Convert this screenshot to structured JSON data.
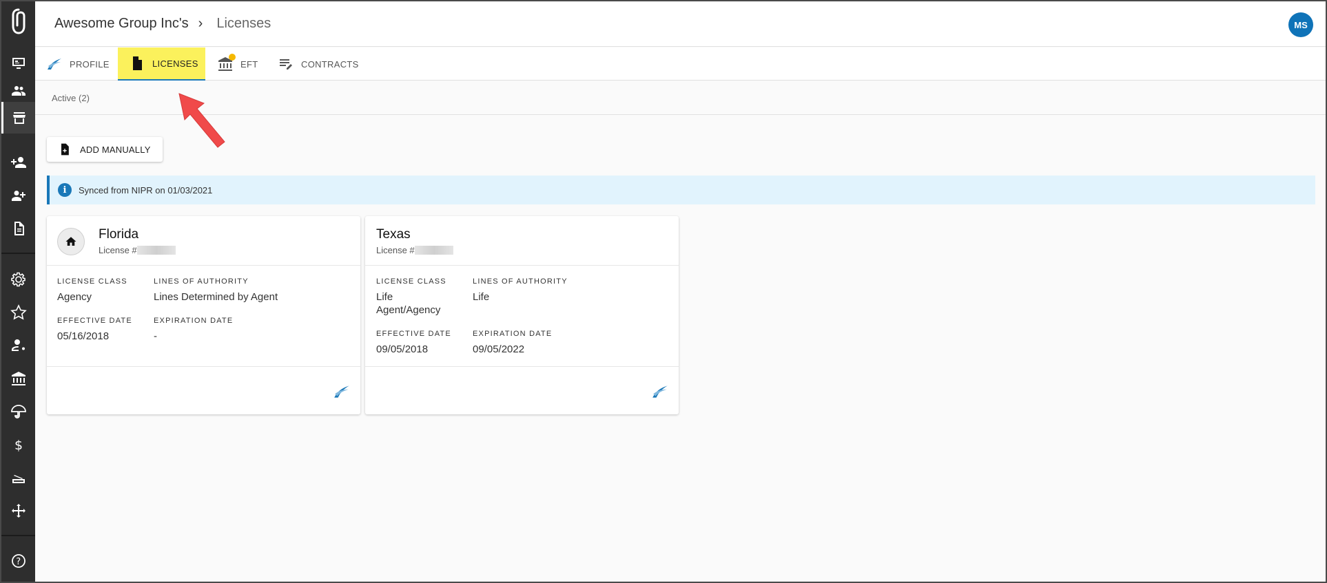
{
  "header": {
    "breadcrumb_root": "Awesome Group Inc's",
    "breadcrumb_separator": "›",
    "breadcrumb_current": "Licenses",
    "avatar_initials": "MS"
  },
  "tabs": [
    {
      "label": "PROFILE",
      "icon": "nipr-swoosh-icon",
      "selected": false
    },
    {
      "label": "LICENSES",
      "icon": "document-icon",
      "selected": true
    },
    {
      "label": "EFT",
      "icon": "bank-icon",
      "selected": false,
      "has_notification_dot": true
    },
    {
      "label": "CONTRACTS",
      "icon": "edit-list-icon",
      "selected": false
    }
  ],
  "subtabs": {
    "active_label": "Active (2)"
  },
  "actions": {
    "add_manually_label": "ADD MANUALLY"
  },
  "banner": {
    "text": "Synced from NIPR on 01/03/2021",
    "info_glyph": "i"
  },
  "licenses": [
    {
      "state": "Florida",
      "license_prefix": "License #",
      "resident_home": true,
      "license_class_label": "LICENSE CLASS",
      "license_class": "Agency",
      "lines_label": "LINES OF AUTHORITY",
      "lines": "Lines Determined by Agent",
      "effective_label": "EFFECTIVE DATE",
      "effective_date": "05/16/2018",
      "expiration_label": "EXPIRATION DATE",
      "expiration_date": "-"
    },
    {
      "state": "Texas",
      "license_prefix": "License #",
      "resident_home": false,
      "license_class_label": "LICENSE CLASS",
      "license_class_line1": "Life",
      "license_class_line2": "Agent/Agency",
      "lines_label": "LINES OF AUTHORITY",
      "lines": "Life",
      "effective_label": "EFFECTIVE DATE",
      "effective_date": "09/05/2018",
      "expiration_label": "EXPIRATION DATE",
      "expiration_date": "09/05/2022"
    }
  ],
  "colors": {
    "sidebar_bg": "#2e2e2e",
    "accent_blue": "#1a78b8",
    "selected_tab_highlight": "#fbf15c",
    "banner_bg": "#e1f3fd",
    "avatar_bg": "#0f73b8",
    "annotation_arrow": "#f04a4a"
  }
}
